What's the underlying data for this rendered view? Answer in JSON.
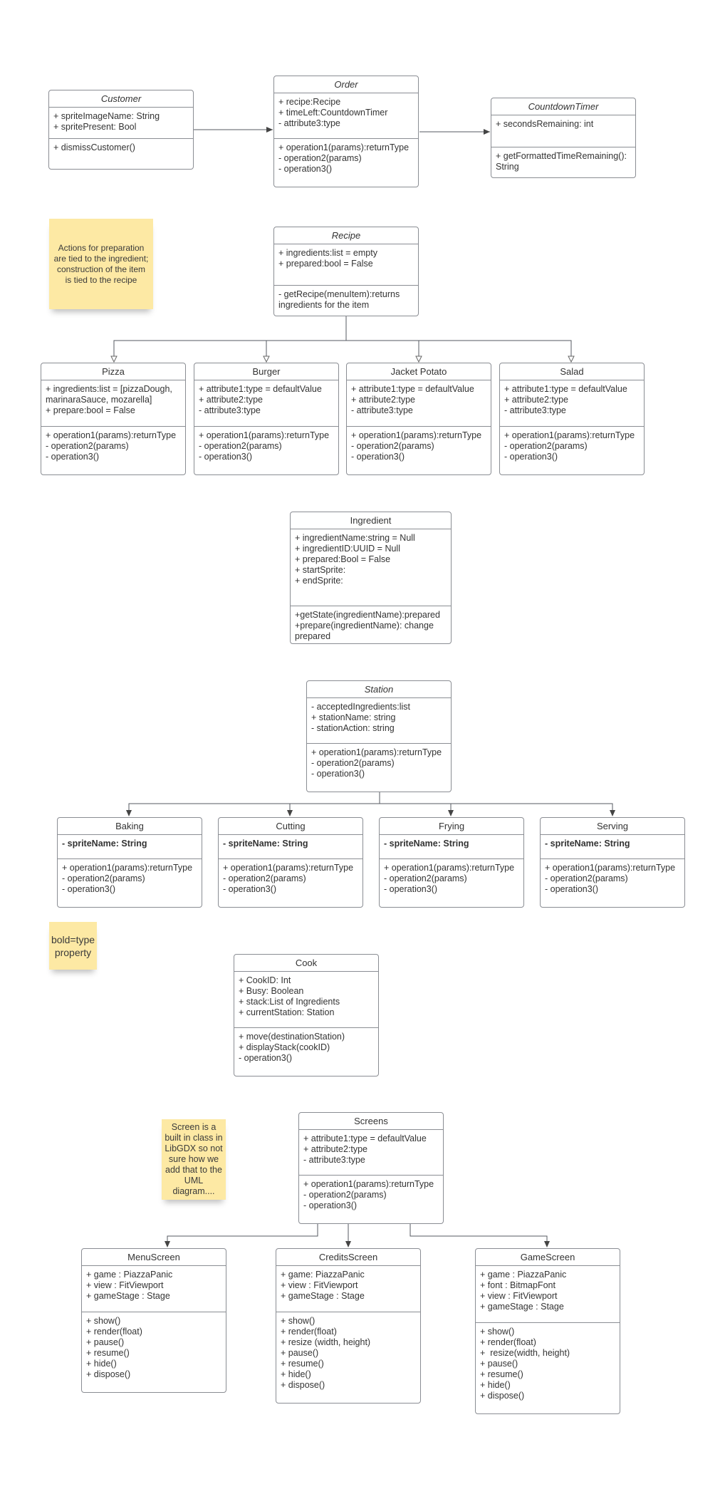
{
  "classes": {
    "customer": {
      "name": "Customer",
      "attributes": [
        "+ spriteImageName: String",
        "+ spritePresent: Bool"
      ],
      "operations": [
        "+ dismissCustomer()"
      ]
    },
    "order": {
      "name": "Order",
      "attributes": [
        "+ recipe:Recipe",
        "+ timeLeft:CountdownTimer",
        "- attribute3:type"
      ],
      "operations": [
        "+ operation1(params):returnType",
        "- operation2(params)",
        "- operation3()"
      ]
    },
    "countdown": {
      "name": "CountdownTimer",
      "attributes": [
        "+ secondsRemaining: int"
      ],
      "operations": [
        "+ getFormattedTimeRemaining(): String"
      ]
    },
    "recipe": {
      "name": "Recipe",
      "attributes": [
        "+ ingredients:list = empty",
        "+ prepared:bool = False"
      ],
      "operations": [
        "- getRecipe(menuItem):returns ingredients for the item"
      ]
    },
    "pizza": {
      "name": "Pizza",
      "attributes": [
        "+ ingredients:list = [pizzaDough, marinaraSauce, mozarella]",
        "+ prepare:bool = False"
      ],
      "operations": [
        "+ operation1(params):returnType",
        "- operation2(params)",
        "- operation3()"
      ]
    },
    "burger": {
      "name": "Burger",
      "attributes": [
        "+ attribute1:type = defaultValue",
        "+ attribute2:type",
        "- attribute3:type"
      ],
      "operations": [
        "+ operation1(params):returnType",
        "- operation2(params)",
        "- operation3()"
      ]
    },
    "jacket": {
      "name": "Jacket Potato",
      "attributes": [
        "+ attribute1:type = defaultValue",
        "+ attribute2:type",
        "- attribute3:type"
      ],
      "operations": [
        "+ operation1(params):returnType",
        "- operation2(params)",
        "- operation3()"
      ]
    },
    "salad": {
      "name": "Salad",
      "attributes": [
        "+ attribute1:type = defaultValue",
        "+ attribute2:type",
        "- attribute3:type"
      ],
      "operations": [
        "+ operation1(params):returnType",
        "- operation2(params)",
        "- operation3()"
      ]
    },
    "ingredient": {
      "name": "Ingredient",
      "attributes": [
        "+ ingredientName:string = Null",
        "+ ingredientID:UUID = Null",
        "+ prepared:Bool = False",
        "+ startSprite:",
        "+ endSprite:"
      ],
      "operations": [
        "+getState(ingredientName):prepared",
        "+prepare(ingredientName): change prepared"
      ]
    },
    "station": {
      "name": "Station",
      "attributes": [
        "- acceptedIngredients:list",
        "+ stationName: string",
        "- stationAction: string"
      ],
      "operations": [
        "+ operation1(params):returnType",
        "- operation2(params)",
        "- operation3()"
      ]
    },
    "baking": {
      "name": "Baking",
      "attributes": [
        "- spriteName: String"
      ],
      "operations": [
        "+ operation1(params):returnType",
        "- operation2(params)",
        "- operation3()"
      ]
    },
    "cutting": {
      "name": "Cutting",
      "attributes": [
        "- spriteName: String"
      ],
      "operations": [
        "+ operation1(params):returnType",
        "- operation2(params)",
        "- operation3()"
      ]
    },
    "frying": {
      "name": "Frying",
      "attributes": [
        "- spriteName: String"
      ],
      "operations": [
        "+ operation1(params):returnType",
        "- operation2(params)",
        "- operation3()"
      ]
    },
    "serving": {
      "name": "Serving",
      "attributes": [
        "- spriteName: String"
      ],
      "operations": [
        "+ operation1(params):returnType",
        "- operation2(params)",
        "- operation3()"
      ]
    },
    "cook": {
      "name": "Cook",
      "attributes": [
        "+ CookID: Int",
        "+ Busy: Boolean",
        "+ stack:List of Ingredients",
        "+ currentStation: Station"
      ],
      "operations": [
        "+ move(destinationStation)",
        "+ displayStack(cookID)",
        "- operation3()"
      ]
    },
    "screens": {
      "name": "Screens",
      "attributes": [
        "+ attribute1:type = defaultValue",
        "+ attribute2:type",
        "- attribute3:type"
      ],
      "operations": [
        "+ operation1(params):returnType",
        "- operation2(params)",
        "- operation3()"
      ]
    },
    "menuscreen": {
      "name": "MenuScreen",
      "attributes": [
        "+ game : PiazzaPanic",
        "+ view : FitViewport",
        "+ gameStage : Stage"
      ],
      "operations": [
        "+ show()",
        "+ render(float)",
        "+ pause()",
        "+ resume()",
        "+ hide()",
        "+ dispose()"
      ]
    },
    "creditsscreen": {
      "name": "CreditsScreen",
      "attributes": [
        "+ game: PiazzaPanic",
        "+ view : FitViewport",
        "+ gameStage : Stage"
      ],
      "operations": [
        "+ show()",
        "+ render(float)",
        "+ resize (width, height)",
        "+ pause()",
        "+ resume()",
        "+ hide()",
        "+ dispose()"
      ]
    },
    "gamescreen": {
      "name": "GameScreen",
      "attributes": [
        "+ game : PiazzaPanic",
        "+ font : BitmapFont",
        "+ view : FitViewport",
        "+ gameStage : Stage"
      ],
      "operations": [
        "+ show()",
        "+ render(float)",
        "+  resize(width, height)",
        "+ pause()",
        "+ resume()",
        "+ hide()",
        "+ dispose()"
      ]
    }
  },
  "notes": {
    "recipe_note": "Actions for preparation are tied to the ingredient; construction of the item is tied to the recipe",
    "bold_note": "bold=type property",
    "screen_note": "Screen is a built in class in LibGDX so not sure how we add that to the UML diagram...."
  },
  "colors": {
    "note": "#fde9a4",
    "border": "#8a8d93",
    "line": "#555a60"
  }
}
